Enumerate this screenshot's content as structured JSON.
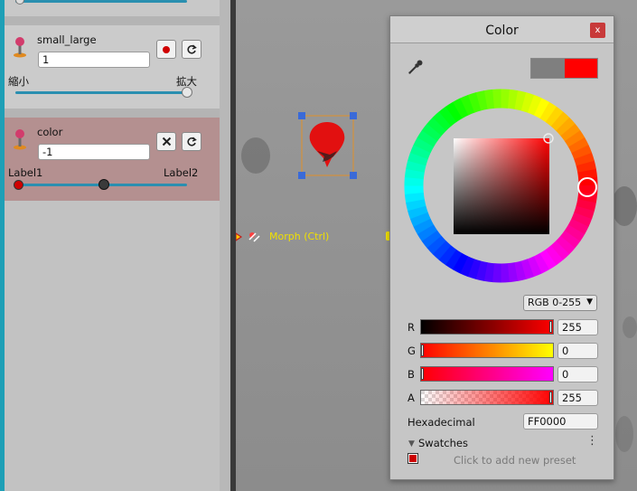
{
  "inspector": {
    "blocks": [
      {
        "name": "small_large",
        "value": "1",
        "left_label": "縮小",
        "right_label": "拡大",
        "slider_value": 1.0
      },
      {
        "name": "color",
        "value": "-1",
        "left_label": "Label1",
        "right_label": "Label2",
        "slider_value": 0.5
      }
    ]
  },
  "scene": {
    "morph_label": "Morph (Ctrl)"
  },
  "color_window": {
    "title": "Color",
    "close_glyph": "x",
    "old_color": "#7f7f7f",
    "new_color": "#ff0000",
    "mode": "RGB 0-255",
    "channels": [
      {
        "label": "R",
        "value": "255"
      },
      {
        "label": "G",
        "value": "0"
      },
      {
        "label": "B",
        "value": "0"
      },
      {
        "label": "A",
        "value": "255"
      }
    ],
    "hex_label": "Hexadecimal",
    "hex_value": "FF0000",
    "swatches_label": "Swatches",
    "swatches_hint": "Click to add new preset",
    "swatch_color": "#cc0000"
  }
}
